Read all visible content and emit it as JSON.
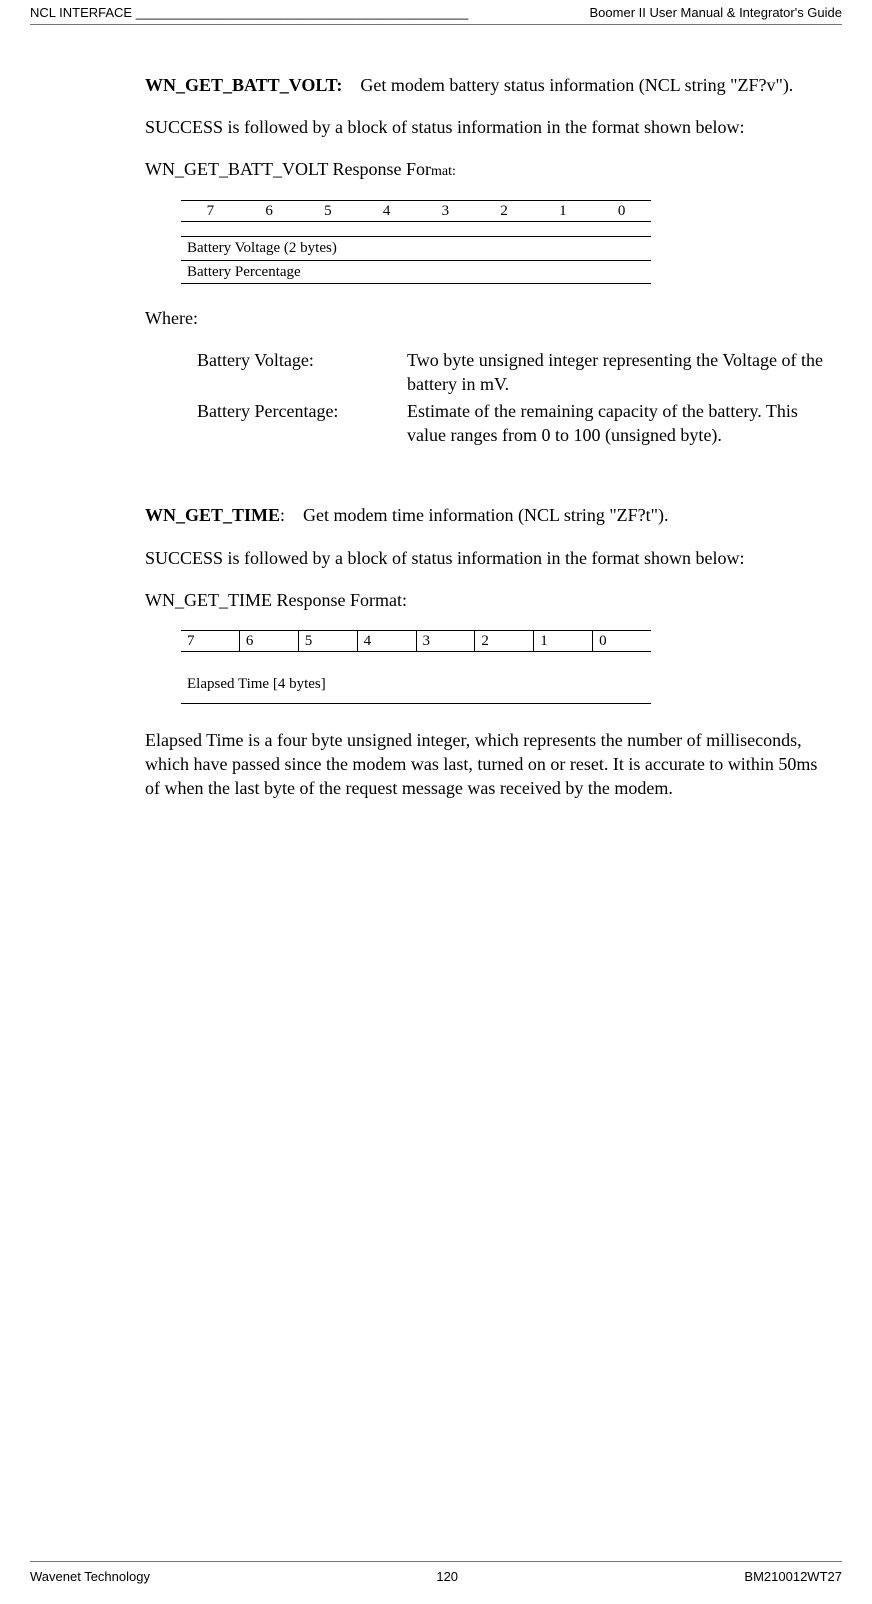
{
  "header": {
    "left": "NCL INTERFACE ______________________________________________",
    "right": "Boomer II User Manual & Integrator's Guide"
  },
  "batt": {
    "title": "WN_GET_BATT_VOLT:",
    "desc": "Get modem battery status information (NCL string \"ZF?v\").",
    "p2": "SUCCESS is followed by a block of status information in the format shown below:",
    "respLabel": "WN_GET_BATT_VOLT Response For",
    "respSuffix": "mat:",
    "bits": [
      "7",
      "6",
      "5",
      "4",
      "3",
      "2",
      "1",
      "0"
    ],
    "row1": "Battery Voltage (2 bytes)",
    "row2": "Battery Percentage",
    "where": "Where:",
    "def1_term": "Battery Voltage:",
    "def1_desc": "Two byte unsigned integer representing the Voltage of the battery in mV.",
    "def2_term": "Battery Percentage:",
    "def2_desc": "Estimate of the remaining capacity of the battery.  This value ranges from 0 to 100 (unsigned byte)."
  },
  "time": {
    "title": "WN_GET_TIME",
    "colon": ":",
    "desc": "Get modem time information (NCL string \"ZF?t\").",
    "p2": "SUCCESS is followed by a block of status information in the format shown below:",
    "respLabel": "WN_GET_TIME Response Format:",
    "bits": [
      "7",
      "6",
      "5",
      "4",
      "3",
      "2",
      "1",
      "0"
    ],
    "row1": "Elapsed Time [4 bytes]",
    "p3": "Elapsed Time is a four byte unsigned integer, which represents the number of milliseconds, which have passed since the modem was last, turned on or reset.  It is accurate to within 50ms of when the last byte of the request message was received by the modem."
  },
  "footer": {
    "left": "Wavenet Technology",
    "center": "120",
    "right": "BM210012WT27"
  }
}
